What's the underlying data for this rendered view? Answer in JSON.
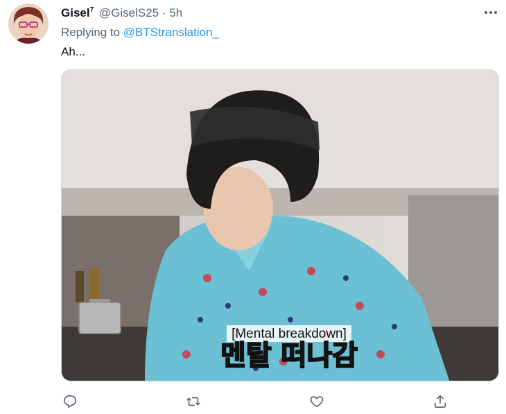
{
  "tweet": {
    "author_name": "Gisel",
    "author_superscript": "7",
    "handle": "@GiselS25",
    "separator": "·",
    "time": "5h",
    "replying_prefix": "Replying to",
    "replying_handle": "@BTStranslation_",
    "text": "Ah...",
    "media": {
      "subtitle_en": "[Mental breakdown]",
      "subtitle_ko": "멘탈 떠나감"
    }
  },
  "icons": {
    "more": "more-horizontal-icon",
    "reply": "reply-bubble-icon",
    "retweet": "retweet-icon",
    "like": "heart-icon",
    "share": "share-upload-icon"
  },
  "colors": {
    "accent": "#1d9bf0",
    "muted": "#536471",
    "text": "#0f1419",
    "shirt": "#6cc0d4"
  }
}
